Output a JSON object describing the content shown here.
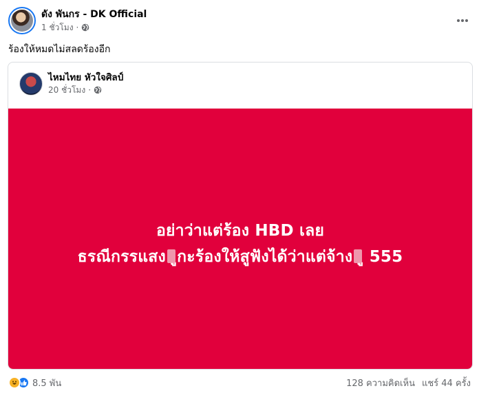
{
  "post": {
    "author": "ดัง พันกร - DK Official",
    "time": "1 ชั่วโมง",
    "separator": "·",
    "audience_icon": "globe-icon",
    "more_icon": "more-options-icon",
    "caption": "ร้องให้หมดไม่สลดร้องอีก"
  },
  "shared": {
    "author": "ไหมไทย หัวใจศิลป์",
    "time": "20 ชั่วโมง",
    "separator": "·",
    "panel": {
      "line1": "อย่าว่าแต่ร้อง HBD เลย",
      "line2_part1": "ธรณีกรรแสง",
      "line2_part2": "ูกะร้องให้สูฟังได้ว่าแต่จ้าง",
      "line2_part3": "ู 555",
      "background": "#e1003c"
    }
  },
  "footer": {
    "reaction_icons": [
      "haha-icon",
      "like-icon"
    ],
    "reaction_count": "8.5 พัน",
    "comments": "128 ความคิดเห็น",
    "shares": "แชร์ 44 ครั้ง"
  }
}
